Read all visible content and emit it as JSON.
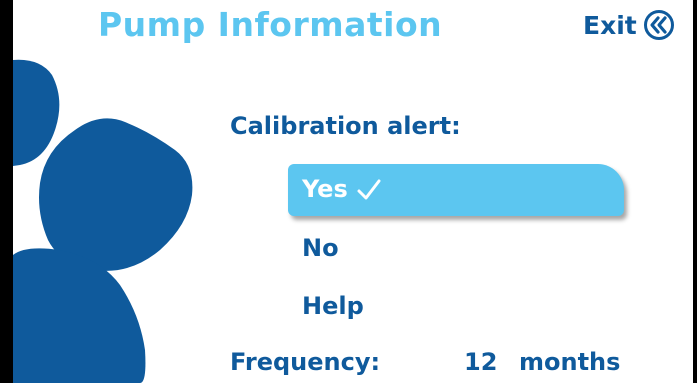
{
  "header": {
    "title": "Pump Information",
    "exit_label": "Exit",
    "exit_icon": "double-chevron-left-icon"
  },
  "calibration": {
    "label": "Calibration alert:",
    "options": [
      {
        "label": "Yes",
        "selected": true,
        "icon": "checkmark-icon"
      },
      {
        "label": "No",
        "selected": false
      },
      {
        "label": "Help",
        "selected": false
      }
    ]
  },
  "frequency": {
    "label": "Frequency:",
    "value": "12",
    "unit": "months"
  },
  "colors": {
    "title": "#5cc6f0",
    "text": "#0f5a9c",
    "highlight": "#5cc6f0",
    "petals": "#0f5a9c"
  }
}
